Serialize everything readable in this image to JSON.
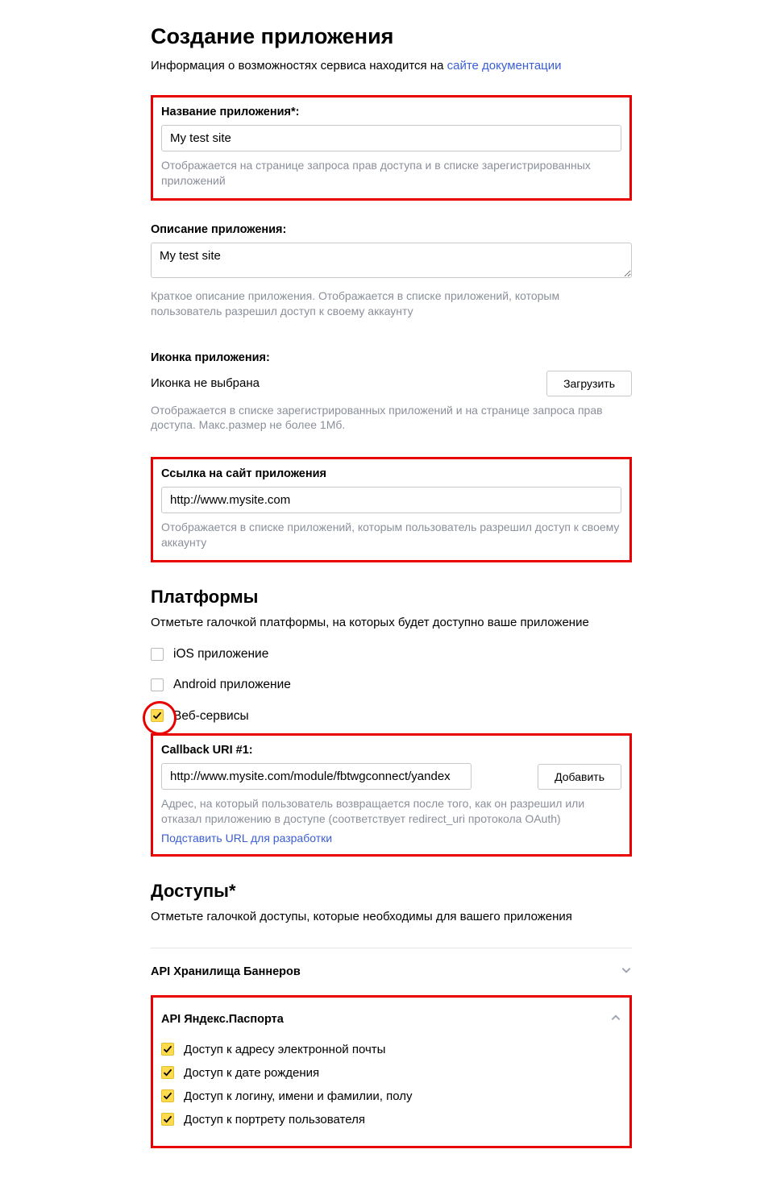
{
  "header": {
    "title": "Создание приложения",
    "intro_prefix": "Информация о возможностях сервиса находится на ",
    "intro_link": "сайте документации"
  },
  "app_name": {
    "label": "Название приложения*:",
    "value": "My test site",
    "hint": "Отображается на странице запроса прав доступа и в списке зарегистрированных приложений"
  },
  "app_desc": {
    "label": "Описание приложения:",
    "value": "My test site",
    "hint": "Краткое описание приложения. Отображается в списке приложений, которым пользователь разрешил доступ к своему аккаунту"
  },
  "app_icon": {
    "label": "Иконка приложения:",
    "state": "Иконка не выбрана",
    "upload_btn": "Загрузить",
    "hint": "Отображается в списке зарегистрированных приложений и на странице запроса прав доступа. Макс.размер не более 1Мб."
  },
  "app_site": {
    "label": "Ссылка на сайт приложения",
    "value": "http://www.mysite.com",
    "hint": "Отображается в списке приложений, которым пользователь разрешил доступ к своему аккаунту"
  },
  "platforms": {
    "heading": "Платформы",
    "sub": "Отметьте галочкой платформы, на которых будет доступно ваше приложение",
    "ios": "iOS приложение",
    "android": "Android приложение",
    "web": "Веб-сервисы"
  },
  "callback": {
    "label": "Callback URI #1:",
    "value": "http://www.mysite.com/module/fbtwgconnect/yandex",
    "add_btn": "Добавить",
    "hint": "Адрес, на который пользователь возвращается после того, как он разрешил или отказал приложению в доступе (соответствует redirect_uri протокола OAuth)",
    "dev_link": "Подставить URL для разработки"
  },
  "accesses": {
    "heading": "Доступы*",
    "sub": "Отметьте галочкой доступы, которые необходимы для вашего приложения",
    "banner_api": "API Хранилища Баннеров",
    "passport_api": "API Яндекс.Паспорта",
    "scopes": {
      "email": "Доступ к адресу электронной почты",
      "birthday": "Доступ к дате рождения",
      "login": "Доступ к логину, имени и фамилии, полу",
      "avatar": "Доступ к портрету пользователя"
    }
  }
}
